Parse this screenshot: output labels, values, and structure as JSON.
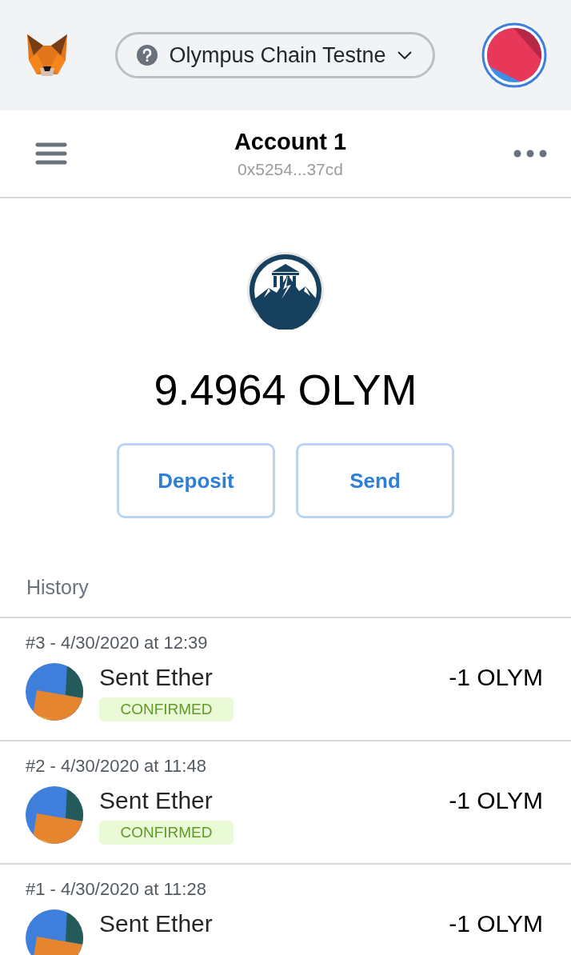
{
  "network": {
    "label": "Olympus Chain Testne"
  },
  "account": {
    "name": "Account 1",
    "address": "0x5254...37cd"
  },
  "balance": {
    "amount": "9.4964 OLYM"
  },
  "buttons": [
    "Deposit",
    "Send"
  ],
  "history": {
    "title": "History",
    "transactions": [
      {
        "meta": "#3 - 4/30/2020 at 12:39",
        "title": "Sent Ether",
        "amount": "-1 OLYM",
        "status": "CONFIRMED"
      },
      {
        "meta": "#2 - 4/30/2020 at 11:48",
        "title": "Sent Ether",
        "amount": "-1 OLYM",
        "status": "CONFIRMED"
      },
      {
        "meta": "#1 - 4/30/2020 at 11:28",
        "title": "Sent Ether",
        "amount": "-1 OLYM"
      }
    ]
  }
}
